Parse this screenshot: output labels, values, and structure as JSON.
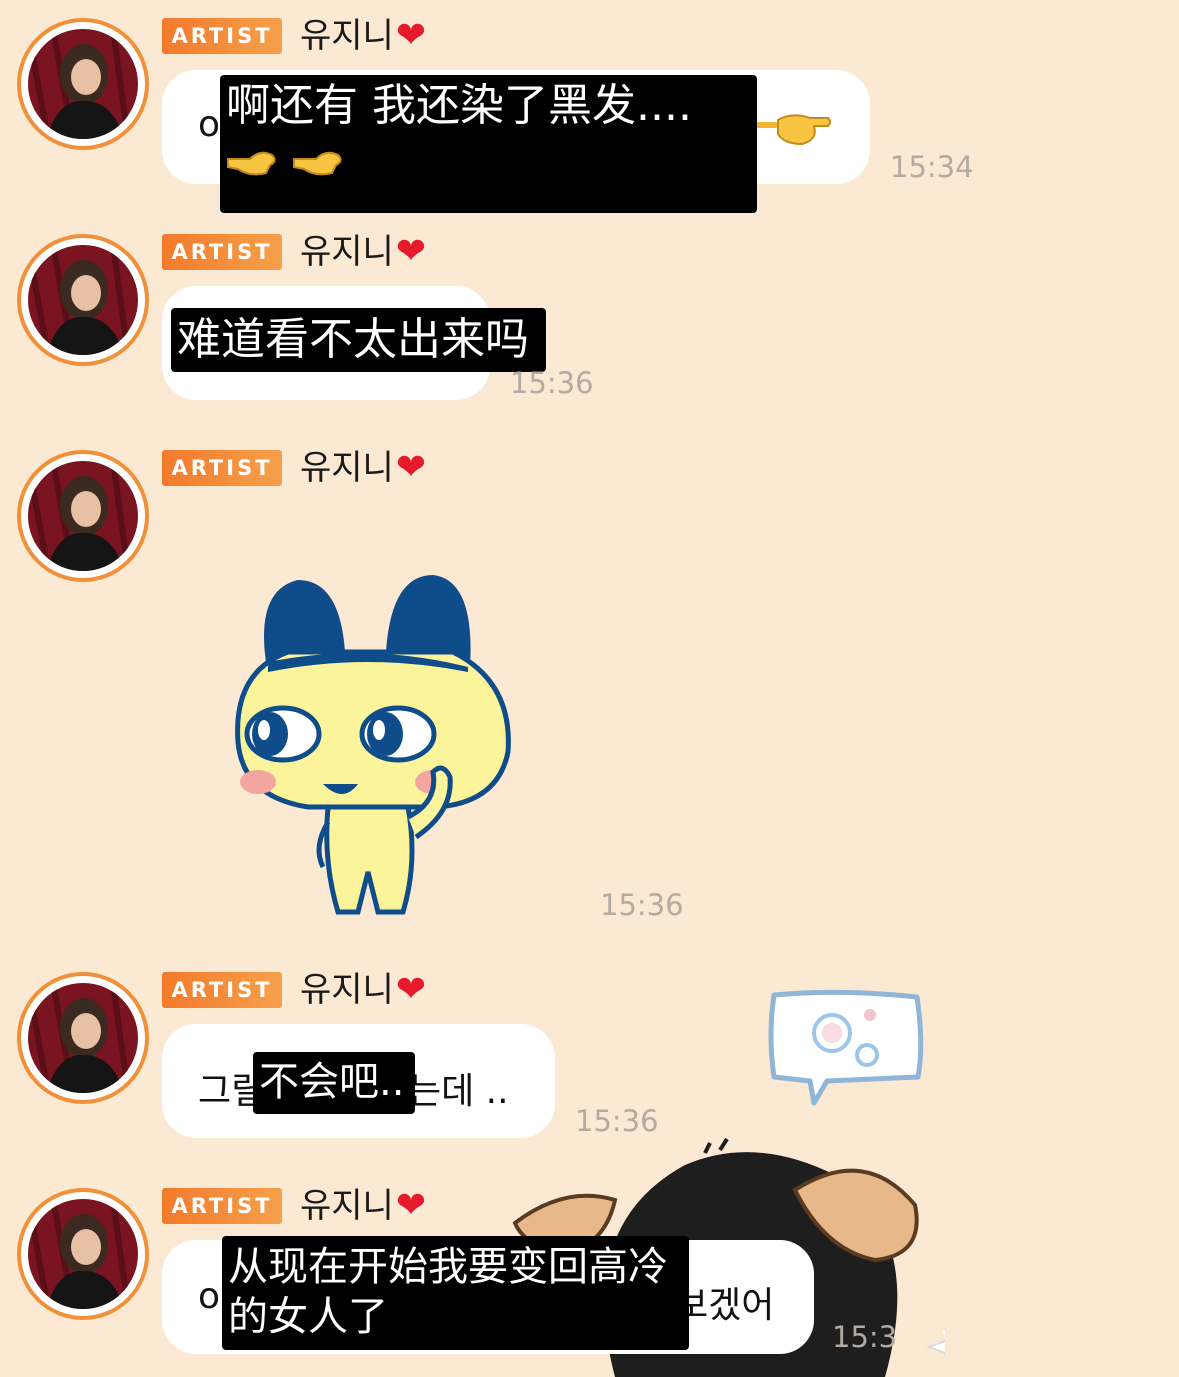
{
  "messages": [
    {
      "badge": "ARTIST",
      "name": "유지니",
      "heart": "❤",
      "bubble_text": "o",
      "caption": "啊还有 我还染了黑发....",
      "time": "15:34"
    },
    {
      "badge": "ARTIST",
      "name": "유지니",
      "heart": "❤",
      "caption": "难道看不太出来吗",
      "time": "15:36"
    },
    {
      "badge": "ARTIST",
      "name": "유지니",
      "heart": "❤",
      "sticker": "mametchi-thinking-sticker",
      "time": "15:36"
    },
    {
      "badge": "ARTIST",
      "name": "유지니",
      "heart": "❤",
      "bubble_text_left": "그릴",
      "bubble_text_right": "는데 ..",
      "caption": "不会吧..",
      "time": "15:36"
    },
    {
      "badge": "ARTIST",
      "name": "유지니",
      "heart": "❤",
      "bubble_text_left": "o",
      "bubble_text_right": "보겠어",
      "caption": "从现在开始我要变回高冷的女人了",
      "time": "15:3"
    }
  ],
  "colors": {
    "background": "#fce9d3",
    "badge": "#f37a2b",
    "heart": "#e51a2a",
    "timestamp": "#b3aaa2"
  }
}
